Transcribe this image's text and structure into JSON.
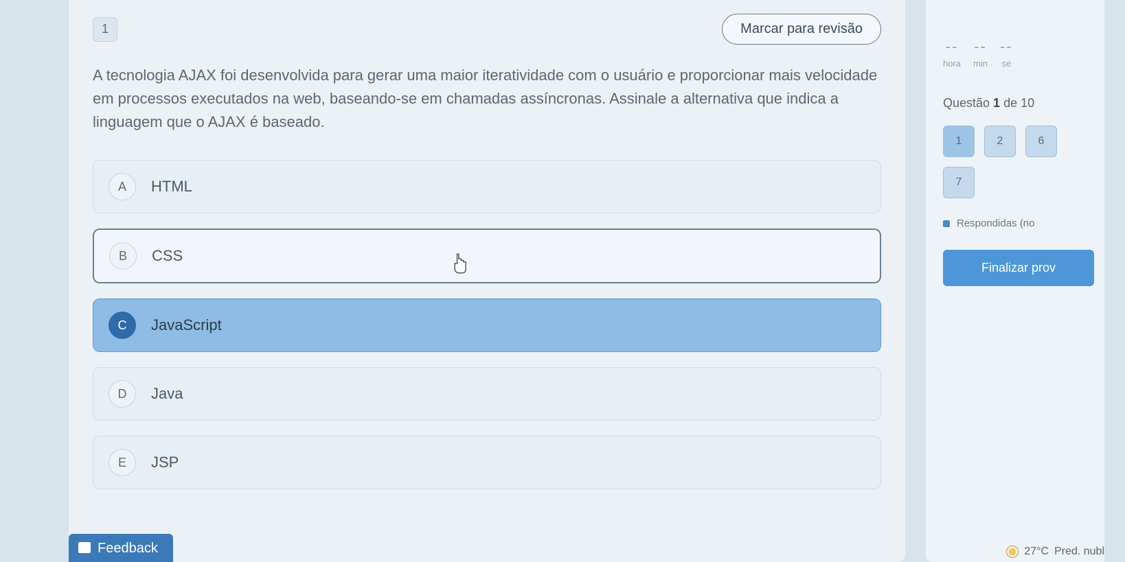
{
  "question": {
    "number": "1",
    "mark_review_label": "Marcar para revisão",
    "text": "A tecnologia AJAX foi desenvolvida para gerar uma maior iteratividade com o usuário e proporcionar mais velocidade em processos executados na web, baseando-se em chamadas assíncronas. Assinale a alternativa que indica a linguagem que o AJAX é baseado.",
    "options": [
      {
        "letter": "A",
        "label": "HTML",
        "state": "default"
      },
      {
        "letter": "B",
        "label": "CSS",
        "state": "hover"
      },
      {
        "letter": "C",
        "label": "JavaScript",
        "state": "selected"
      },
      {
        "letter": "D",
        "label": "Java",
        "state": "default"
      },
      {
        "letter": "E",
        "label": "JSP",
        "state": "default"
      }
    ]
  },
  "sidebar": {
    "timer": {
      "hora_val": "--",
      "hora_lbl": "hora",
      "min_val": "--",
      "min_lbl": "min",
      "sec_val": "--",
      "sec_lbl": "se"
    },
    "counter_prefix": "Questão ",
    "counter_current": "1",
    "counter_middle": " de ",
    "counter_total": "10",
    "nav_items": [
      "1",
      "2",
      "6",
      "7"
    ],
    "legend_label": "Respondidas (no",
    "finish_label": "Finalizar prov"
  },
  "feedback_label": "Feedback",
  "weather": {
    "temp": "27°C",
    "desc": "Pred. nubl"
  }
}
